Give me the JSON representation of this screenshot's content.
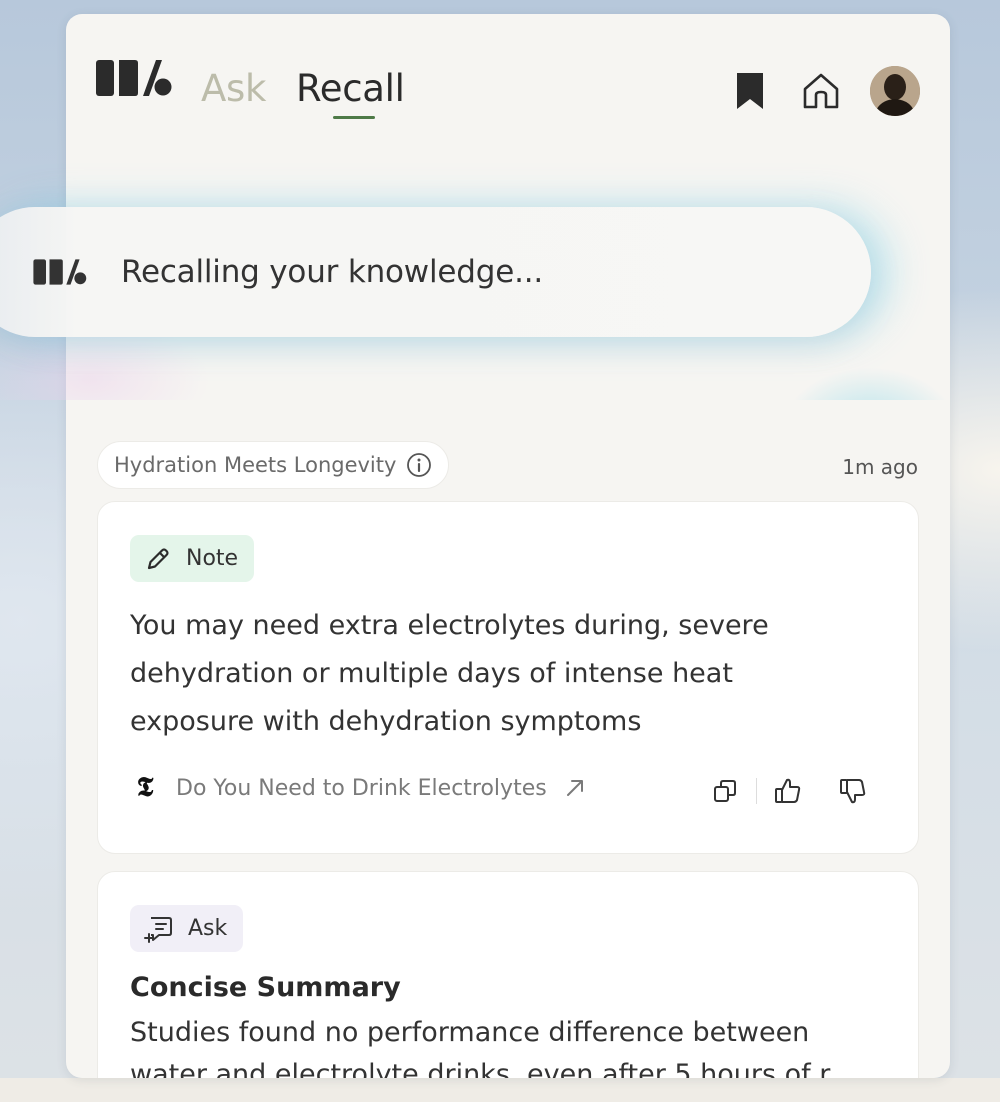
{
  "header": {
    "tabs": [
      {
        "label": "Ask",
        "active": false
      },
      {
        "label": "Recall",
        "active": true
      }
    ],
    "icons": [
      "bookmark-icon",
      "home-icon",
      "avatar"
    ]
  },
  "status": {
    "text": "Recalling your knowledge..."
  },
  "topic": {
    "label": "Hydration Meets Longevity",
    "time_ago": "1m ago"
  },
  "cards": {
    "note": {
      "badge": "Note",
      "text": "You may need extra electrolytes during, severe dehydration or multiple days of intense heat exposure with dehydration symptoms",
      "source_logo": "𝕿",
      "source_title": "Do You Need to Drink Electrolytes"
    },
    "ask": {
      "badge": "Ask",
      "title": "Concise Summary",
      "text": "Studies found no performance difference between water and electrolyte drinks, even after 5 hours of r"
    }
  },
  "colors": {
    "accent_green": "#4e7a47",
    "note_badge_bg": "#e4f5ea",
    "ask_badge_bg": "#f1eff7",
    "inactive_tab": "#bcbcaa"
  }
}
